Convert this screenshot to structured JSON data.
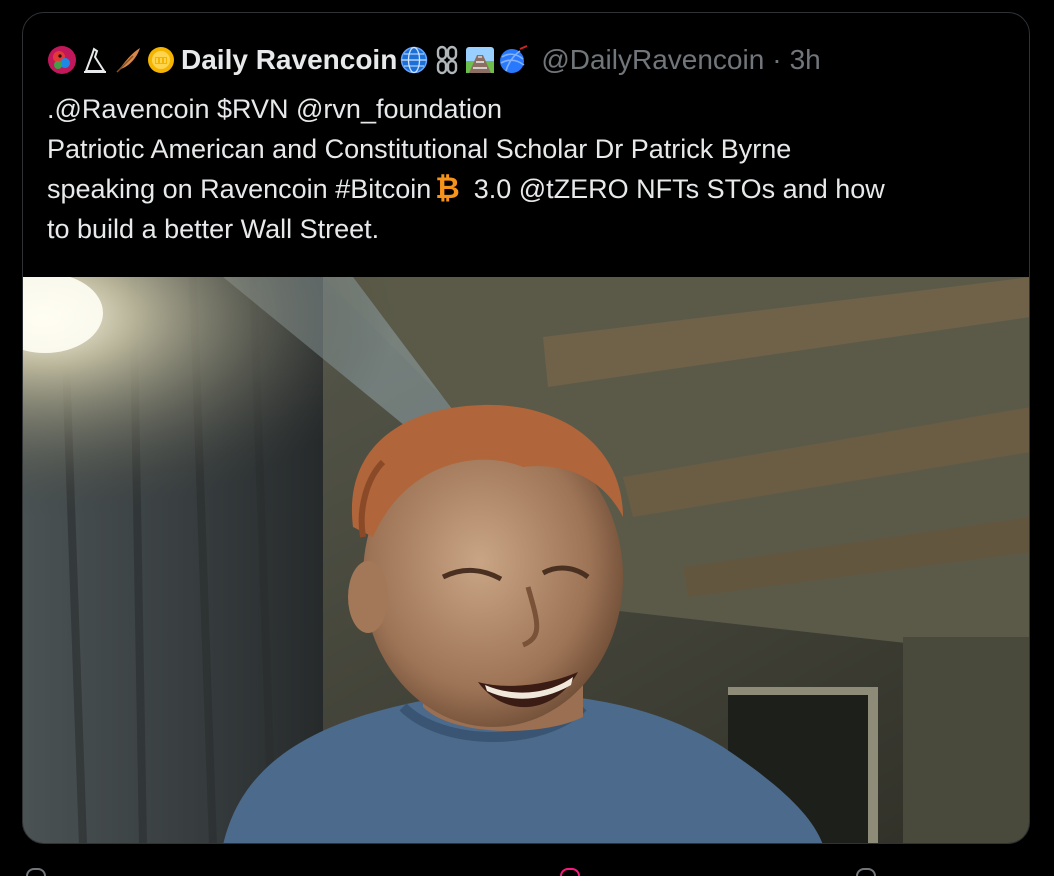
{
  "tweet": {
    "display_name": "Daily Ravencoin",
    "handle": "@DailyRavencoin",
    "separator": "·",
    "time": "3h",
    "name_emojis_before": [
      "parrot-avatar-icon",
      "hieroglyph-icon",
      "feather-icon",
      "coin-icon"
    ],
    "name_emojis_after": [
      "globe-icon",
      "chain-link-icon",
      "railway-icon",
      "yarn-ball-icon"
    ],
    "text_lines": [
      ".@Ravencoin $RVN @rvn_foundation",
      "Patriotic American and Constitutional Scholar Dr Patrick Byrne",
      "speaking on Ravencoin #Bitcoin",
      "3.0 @tZERO NFTs STOs  and how",
      "to build a better Wall Street."
    ],
    "bitcoin_symbol": "₿"
  },
  "media": {
    "type": "video-frame",
    "description_icon": "video-frame-icon"
  },
  "colors": {
    "background": "#000000",
    "text_primary": "#e7e9ea",
    "text_secondary": "#71767b",
    "border": "#2f3336",
    "bitcoin_orange": "#f7931a",
    "like_red": "#f91880"
  }
}
